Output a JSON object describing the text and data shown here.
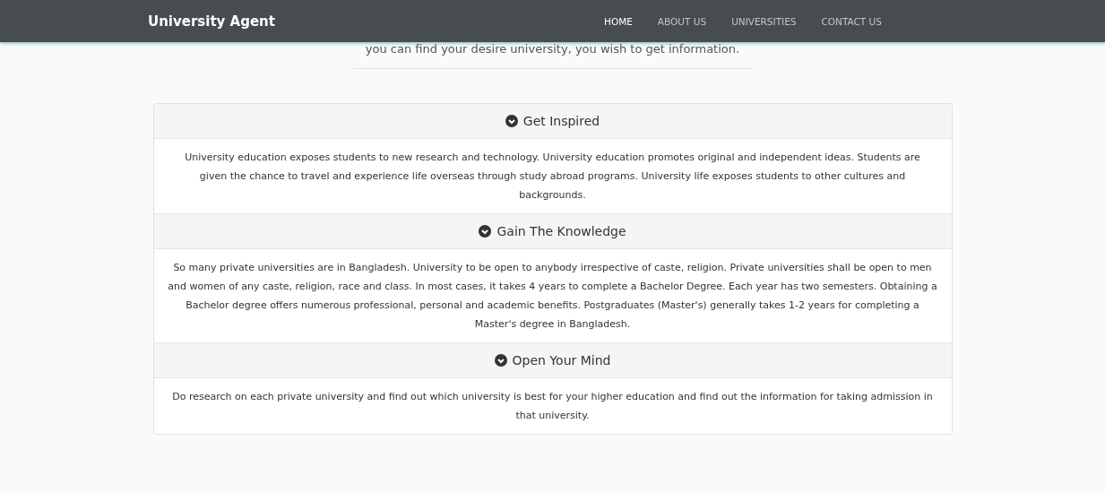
{
  "navbar": {
    "brand": "University Agent",
    "links": [
      {
        "label": "HOME",
        "selected": true
      },
      {
        "label": "ABOUT US",
        "selected": false
      },
      {
        "label": "UNIVERSITIES",
        "selected": false
      },
      {
        "label": "CONTACT US",
        "selected": false
      }
    ]
  },
  "intro": "you can find your desire university, you wish to get information.",
  "sections": [
    {
      "title": "Get Inspired",
      "text": "University education exposes students to new research and technology. University education promotes original and independent ideas. Students are given the chance to travel and experience life overseas through study abroad programs. University life exposes students to other cultures and backgrounds."
    },
    {
      "title": "Gain The Knowledge",
      "text": "So many private universities are in Bangladesh. University to be open to anybody irrespective of caste, religion. Private universities shall be open to men and women of any caste, religion, race and class. In most cases, it takes 4 years to complete a Bachelor Degree. Each year has two semesters. Obtaining a Bachelor degree offers numerous professional, personal and academic benefits. Postgraduates (Master's) generally takes 1-2 years for completing a Master's degree in Bangladesh."
    },
    {
      "title": "Open Your Mind",
      "text": "Do research on each private university and find out which university is best for your higher education and find out the information for taking admission in that university."
    }
  ]
}
